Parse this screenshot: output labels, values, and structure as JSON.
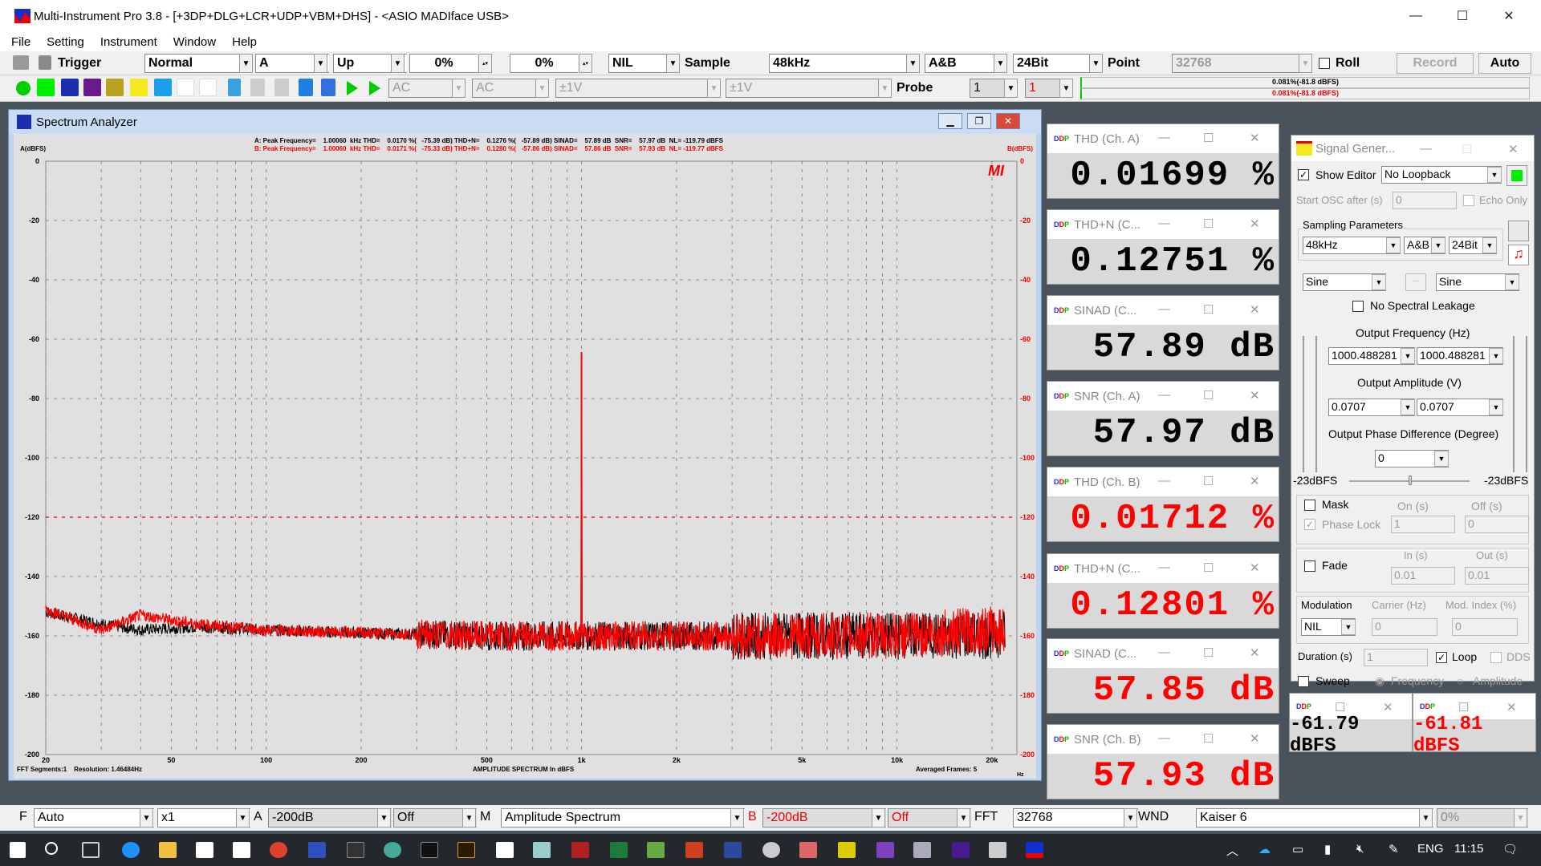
{
  "titlebar": {
    "title": "Multi-Instrument Pro 3.8   -   [+3DP+DLG+LCR+UDP+VBM+DHS]   -   <ASIO MADIface USB>",
    "minimize": "—",
    "maximize": "☐",
    "close": "✕"
  },
  "menu": [
    "File",
    "Setting",
    "Instrument",
    "Window",
    "Help"
  ],
  "toolbar1": {
    "trigger_label": "Trigger",
    "trigger_mode": "Normal",
    "trigger_channel": "A",
    "trigger_edge": "Up",
    "pct1": "0%",
    "pct2": "0%",
    "nil": "NIL",
    "sample_label": "Sample",
    "sample_rate": "48kHz",
    "channels": "A&B",
    "bits": "24Bit",
    "point_label": "Point",
    "points": "32768",
    "roll_label": "Roll",
    "record_label": "Record",
    "auto_label": "Auto"
  },
  "toolbar2": {
    "coupling_a": "AC",
    "coupling_b": "AC",
    "range_a": "±1V",
    "range_b": "±1V",
    "probe_label": "Probe",
    "probe_a": "1",
    "probe_b": "1",
    "level_a": "0.081%(-81.8 dBFS)",
    "level_b": "0.081%(-81.8 dBFS)"
  },
  "spectrum_window": {
    "title": "Spectrum Analyzer",
    "stats_a": "A: Peak Frequency=    1.00060  kHz THD=    0.0170 %(   -75.39 dB) THD+N=    0.1276 %(   -57.89 dB) SINAD=    57.89 dB  SNR=    57.97 dB  NL= -119.79 dBFS",
    "stats_b": "B: Peak Frequency=    1.00060  kHz THD=    0.0171 %(   -75.33 dB) THD+N=    0.1280 %(   -57.86 dB) SINAD=    57.86 dB  SNR=    57.93 dB  NL= -119.77 dBFS",
    "footer_left": "FFT Segments:1    Resolution: 1.46484Hz",
    "footer_center": "AMPLITUDE SPECTRUM In dBFS",
    "footer_right": "Averaged Frames: 5",
    "x_unit": "Hz",
    "logo": "MI"
  },
  "chart_data": {
    "type": "line",
    "title": "AMPLITUDE SPECTRUM In dBFS",
    "xlabel": "Hz",
    "ylabel_left": "A(dBFS)",
    "ylabel_right": "B(dBFS)",
    "xscale": "log",
    "xlim": [
      20,
      24000
    ],
    "ylim": [
      -200,
      0
    ],
    "x_ticks": [
      20,
      50,
      100,
      200,
      500,
      1000,
      2000,
      5000,
      10000,
      20000
    ],
    "x_tick_labels": [
      "20",
      "50",
      "100",
      "200",
      "500",
      "1k",
      "2k",
      "5k",
      "10k",
      "20k"
    ],
    "y_ticks": [
      0,
      -20,
      -40,
      -60,
      -80,
      -100,
      -120,
      -140,
      -160,
      -180,
      -200
    ],
    "grid": true,
    "reference_line": {
      "y": -120,
      "color": "#e00000"
    },
    "series": [
      {
        "name": "A",
        "color": "#000000",
        "noise_floor": [
          [
            20,
            -152
          ],
          [
            30,
            -156
          ],
          [
            40,
            -158
          ],
          [
            60,
            -157
          ],
          [
            100,
            -158
          ],
          [
            200,
            -159
          ],
          [
            500,
            -160
          ],
          [
            1000,
            -160
          ],
          [
            2000,
            -160
          ],
          [
            5000,
            -160
          ],
          [
            10000,
            -160
          ],
          [
            20000,
            -160
          ],
          [
            22000,
            -159
          ]
        ],
        "peaks": [
          {
            "x": 1000.6,
            "y": -64.5
          }
        ]
      },
      {
        "name": "B",
        "color": "#ff0000",
        "noise_floor": [
          [
            20,
            -151
          ],
          [
            30,
            -158
          ],
          [
            40,
            -153
          ],
          [
            60,
            -156
          ],
          [
            100,
            -158
          ],
          [
            200,
            -159
          ],
          [
            500,
            -160
          ],
          [
            1000,
            -160
          ],
          [
            2000,
            -160
          ],
          [
            5000,
            -160
          ],
          [
            10000,
            -160
          ],
          [
            20000,
            -158
          ],
          [
            22000,
            -158
          ]
        ],
        "peaks": [
          {
            "x": 1000.6,
            "y": -64.5
          }
        ]
      }
    ]
  },
  "meters": [
    {
      "title": "THD (Ch. A)",
      "value": "0.01699 %",
      "color": "#000000"
    },
    {
      "title": "THD+N (C...",
      "value": "0.12751 %",
      "color": "#000000"
    },
    {
      "title": "SINAD (C...",
      "value": "57.89 dB",
      "color": "#000000"
    },
    {
      "title": "SNR (Ch. A)",
      "value": "57.97 dB",
      "color": "#000000"
    },
    {
      "title": "THD (Ch. B)",
      "value": "0.01712 %",
      "color": "#ff0000"
    },
    {
      "title": "THD+N (C...",
      "value": "0.12801 %",
      "color": "#ff0000"
    },
    {
      "title": "SINAD (C...",
      "value": "57.85 dB",
      "color": "#ff0000"
    },
    {
      "title": "SNR (Ch. B)",
      "value": "57.93 dB",
      "color": "#ff0000"
    }
  ],
  "small_meters": [
    {
      "value": "-61.79 dBFS",
      "color": "#000000"
    },
    {
      "value": "-61.81 dBFS",
      "color": "#ff0000"
    }
  ],
  "signal_generator": {
    "title": "Signal Gener...",
    "show_editor_label": "Show Editor",
    "show_editor_checked": true,
    "loopback": "No Loopback",
    "start_osc_label": "Start OSC after (s)",
    "start_osc_value": "0",
    "echo_only_label": "Echo Only",
    "sampling_label": "Sampling Parameters",
    "sample_rate": "48kHz",
    "channels": "A&B",
    "bits": "24Bit",
    "wave_a": "Sine",
    "wave_b": "Sine",
    "ellipsis": "...",
    "no_leakage_label": "No Spectral Leakage",
    "freq_label": "Output Frequency (Hz)",
    "freq_a": "1000.488281",
    "freq_b": "1000.488281",
    "amp_label": "Output Amplitude (V)",
    "amp_a": "0.0707",
    "amp_b": "0.0707",
    "phase_label": "Output Phase Difference (Degree)",
    "phase": "0",
    "level_a": "-23dBFS",
    "level_b": "-23dBFS",
    "mask_label": "Mask",
    "on_label": "On (s)",
    "off_label": "Off (s)",
    "phase_lock_label": "Phase Lock",
    "on_value": "1",
    "off_value": "0",
    "fade_label": "Fade",
    "in_label": "In (s)",
    "out_label": "Out (s)",
    "in_value": "0.01",
    "out_value": "0.01",
    "modulation_label": "Modulation",
    "carrier_label": "Carrier (Hz)",
    "mod_index_label": "Mod. Index (%)",
    "modulation": "NIL",
    "carrier_value": "0",
    "mod_index_value": "0",
    "duration_label": "Duration (s)",
    "duration_value": "1",
    "loop_label": "Loop",
    "dds_label": "DDS",
    "sweep_label": "Sweep",
    "frequency_label": "Frequency",
    "amplitude_label": "Amplitude"
  },
  "bottom_toolbar": {
    "f_label": "F",
    "freq_mode": "Auto",
    "zoom": "x1",
    "a_label": "A",
    "a_floor": "-200dB",
    "a_weight": "Off",
    "m_label": "M",
    "mode": "Amplitude Spectrum",
    "b_label": "B",
    "b_floor": "-200dB",
    "b_weight": "Off",
    "fft_label": "FFT",
    "fft_size": "32768",
    "wnd_label": "WND",
    "window": "Kaiser 6",
    "overlap": "0%"
  },
  "taskbar": {
    "lang": "ENG",
    "time": "11:15"
  }
}
